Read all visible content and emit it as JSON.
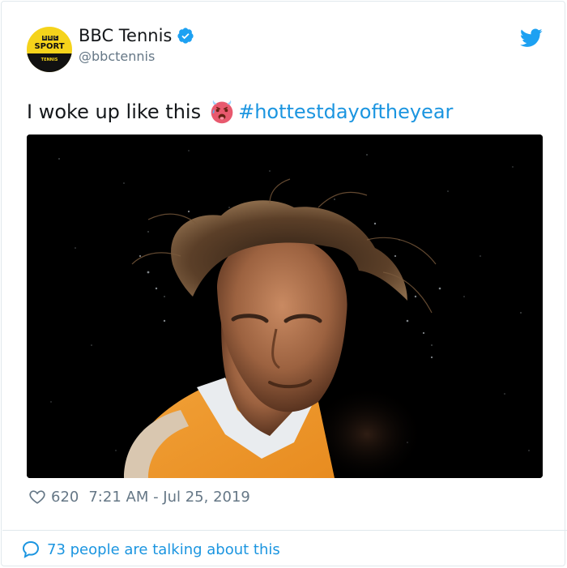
{
  "account": {
    "display_name": "BBC Tennis",
    "handle": "@bbctennis",
    "verified": true,
    "avatar": {
      "logo_letters": [
        "B",
        "B",
        "C"
      ],
      "logo_line1": "SPORT",
      "logo_line2": "TENNIS",
      "color": "#f5d31b"
    }
  },
  "tweet": {
    "text": "I woke up like this",
    "emoji": "hot-face-emoji",
    "hashtag": "#hottestdayoftheyear",
    "media_alt": "tennis-player-hair-flying-photo"
  },
  "stats": {
    "likes": "620",
    "timestamp": "7:21 AM - Jul 25, 2019"
  },
  "footer": {
    "talking_text": "73 people are talking about this"
  },
  "colors": {
    "link": "#1b95e0",
    "muted": "#657786",
    "text": "#14171a",
    "border": "#e1e8ed"
  },
  "icons": {
    "verified": "verified-badge-icon",
    "brand": "twitter-bird-icon",
    "like": "heart-icon",
    "conversation": "speech-bubble-icon"
  }
}
